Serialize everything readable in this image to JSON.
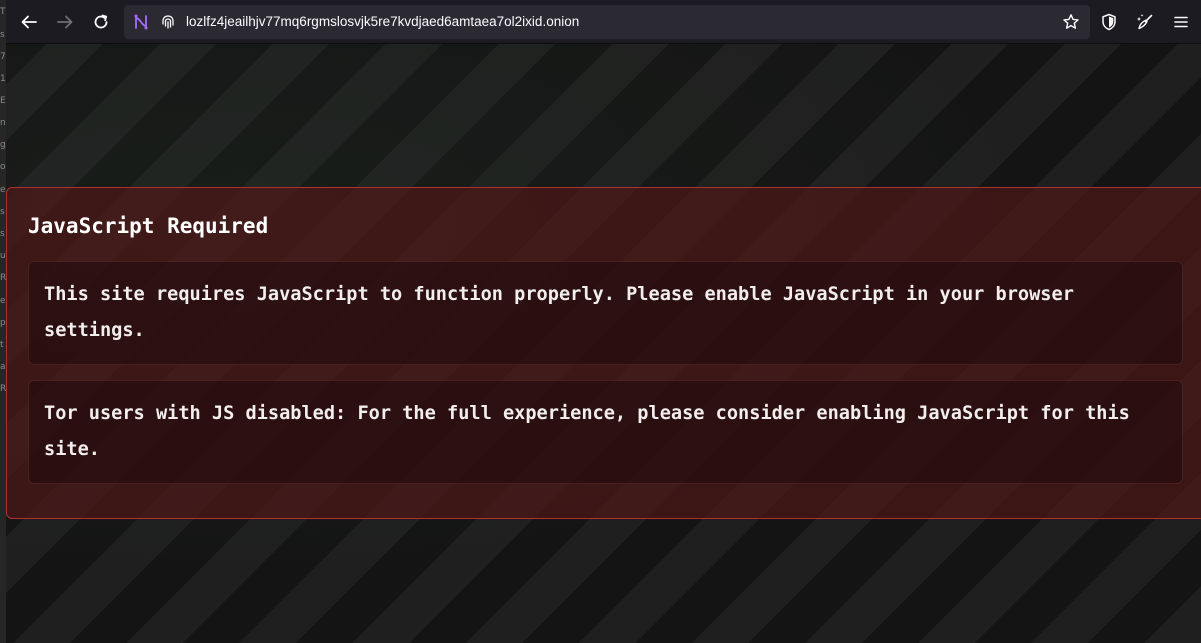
{
  "browser": {
    "url": "lozlfz4jeailhjv77mq6rgmslosvjk5re7kvdjaed6amtaea7ol2ixid.onion",
    "icons": {
      "back": "arrow-left-icon",
      "forward": "arrow-right-icon",
      "reload": "reload-icon",
      "tor": "tor-circuit-icon",
      "fingerprint": "fingerprint-icon",
      "bookmark": "star-icon",
      "shield": "shield-icon",
      "extensions": "broom-icon",
      "menu": "hamburger-menu-icon"
    }
  },
  "left_strip": {
    "chars": [
      "T",
      "s",
      "7",
      "1",
      "E",
      "n",
      "g",
      "o",
      "e",
      "s",
      "s",
      "u",
      "R",
      "e",
      "p",
      "t",
      "a",
      "R"
    ]
  },
  "alert": {
    "title": "JavaScript Required",
    "message_1": "This site requires JavaScript to function properly. Please enable JavaScript in your browser settings.",
    "message_2": "Tor users with JS disabled: For the full experience, please consider enabling JavaScript for this site."
  },
  "colors": {
    "alert_border": "#b03030",
    "alert_bg": "#551616",
    "toolbar_bg": "#1c1b22",
    "urlbar_bg": "#2b2a33"
  }
}
